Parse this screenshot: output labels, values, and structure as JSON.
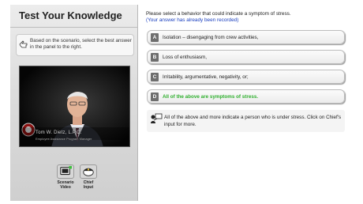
{
  "left_panel": {
    "title": "Test Your Knowledge",
    "instruction": "Based on the scenario, select the best answer in the panel to the right.",
    "video": {
      "caption_name": "Tom W. Dietz, L.P.C.",
      "caption_subtitle": "Employee Assistance Program Manager"
    },
    "tools": [
      {
        "label_line1": "Scenario",
        "label_line2": "Video",
        "icon": "video-icon"
      },
      {
        "label_line1": "Chief",
        "label_line2": "Input",
        "icon": "chief-icon"
      }
    ]
  },
  "right_panel": {
    "prompt": "Please select a behavior that could indicate a symptom of stress.",
    "recorded_note": "(Your answer has already been recorded)",
    "options": [
      {
        "letter": "A",
        "text": "Isolation – disengaging from crew activities,"
      },
      {
        "letter": "B",
        "text": "Loss of enthusiasm,"
      },
      {
        "letter": "C",
        "text": "Irritability, argumentative, negativity, or;"
      },
      {
        "letter": "D",
        "text": "All of the above are symptoms of stress."
      }
    ],
    "correct_color": "#30b02f",
    "feedback": "All of the above and more indicate a person who is under stress. Click on Chief's input for more."
  }
}
